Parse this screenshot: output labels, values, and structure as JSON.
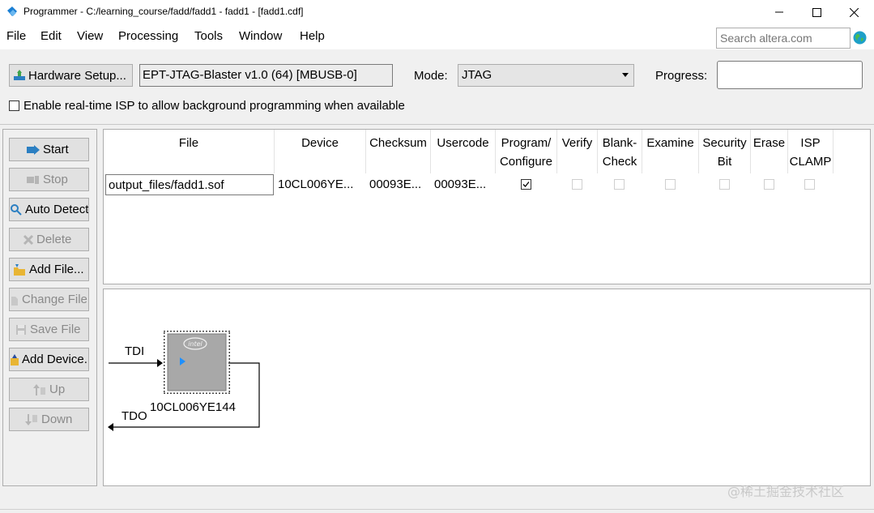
{
  "window": {
    "title": "Programmer - C:/learning_course/fadd/fadd1 - fadd1 - [fadd1.cdf]",
    "controls": [
      "minimize-icon",
      "maximize-icon",
      "close-icon"
    ]
  },
  "menu": {
    "items": [
      "File",
      "Edit",
      "View",
      "Processing",
      "Tools",
      "Window",
      "Help"
    ],
    "search_placeholder": "Search altera.com"
  },
  "toolbar": {
    "hardware_setup_label": "Hardware Setup...",
    "hardware_value": "EPT-JTAG-Blaster v1.0 (64) [MBUSB-0]",
    "mode_label": "Mode:",
    "mode_value": "JTAG",
    "progress_label": "Progress:",
    "isp_label": "Enable real-time ISP to allow background programming when available",
    "isp_checked": false
  },
  "side_buttons": [
    {
      "label": "Start",
      "icon": "start-icon",
      "enabled": true
    },
    {
      "label": "Stop",
      "icon": "stop-icon",
      "enabled": false
    },
    {
      "label": "Auto Detect",
      "icon": "auto-detect-icon",
      "enabled": true
    },
    {
      "label": "Delete",
      "icon": "delete-icon",
      "enabled": false
    },
    {
      "label": "Add File...",
      "icon": "add-file-icon",
      "enabled": true
    },
    {
      "label": "Change File...",
      "icon": "change-file-icon",
      "enabled": false
    },
    {
      "label": "Save File",
      "icon": "save-file-icon",
      "enabled": false
    },
    {
      "label": "Add Device...",
      "icon": "add-device-icon",
      "enabled": true
    },
    {
      "label": "Up",
      "icon": "up-icon",
      "enabled": false
    },
    {
      "label": "Down",
      "icon": "down-icon",
      "enabled": false
    }
  ],
  "table": {
    "columns": [
      {
        "line1": "File",
        "line2": ""
      },
      {
        "line1": "Device",
        "line2": ""
      },
      {
        "line1": "Checksum",
        "line2": ""
      },
      {
        "line1": "Usercode",
        "line2": ""
      },
      {
        "line1": "Program/",
        "line2": "Configure"
      },
      {
        "line1": "Verify",
        "line2": ""
      },
      {
        "line1": "Blank-",
        "line2": "Check"
      },
      {
        "line1": "Examine",
        "line2": ""
      },
      {
        "line1": "Security",
        "line2": "Bit"
      },
      {
        "line1": "Erase",
        "line2": ""
      },
      {
        "line1": "ISP",
        "line2": "CLAMP"
      }
    ],
    "rows": [
      {
        "file": "output_files/fadd1.sof",
        "device": "10CL006YE...",
        "checksum": "00093E...",
        "usercode": "00093E...",
        "program_configure": true,
        "verify": false,
        "blank_check": false,
        "examine": false,
        "security_bit": false,
        "erase": false,
        "isp_clamp": false
      }
    ]
  },
  "diagram": {
    "tdi_label": "TDI",
    "tdo_label": "TDO",
    "chip_name": "10CL006YE144",
    "chip_logo": "intel"
  },
  "watermark": "@稀土掘金技术社区",
  "colors": {
    "button_face": "#e1e1e1",
    "panel_bg": "#f0f0f0",
    "chip_body": "#a8a8a8",
    "chip_arrow": "#1e90ff"
  }
}
